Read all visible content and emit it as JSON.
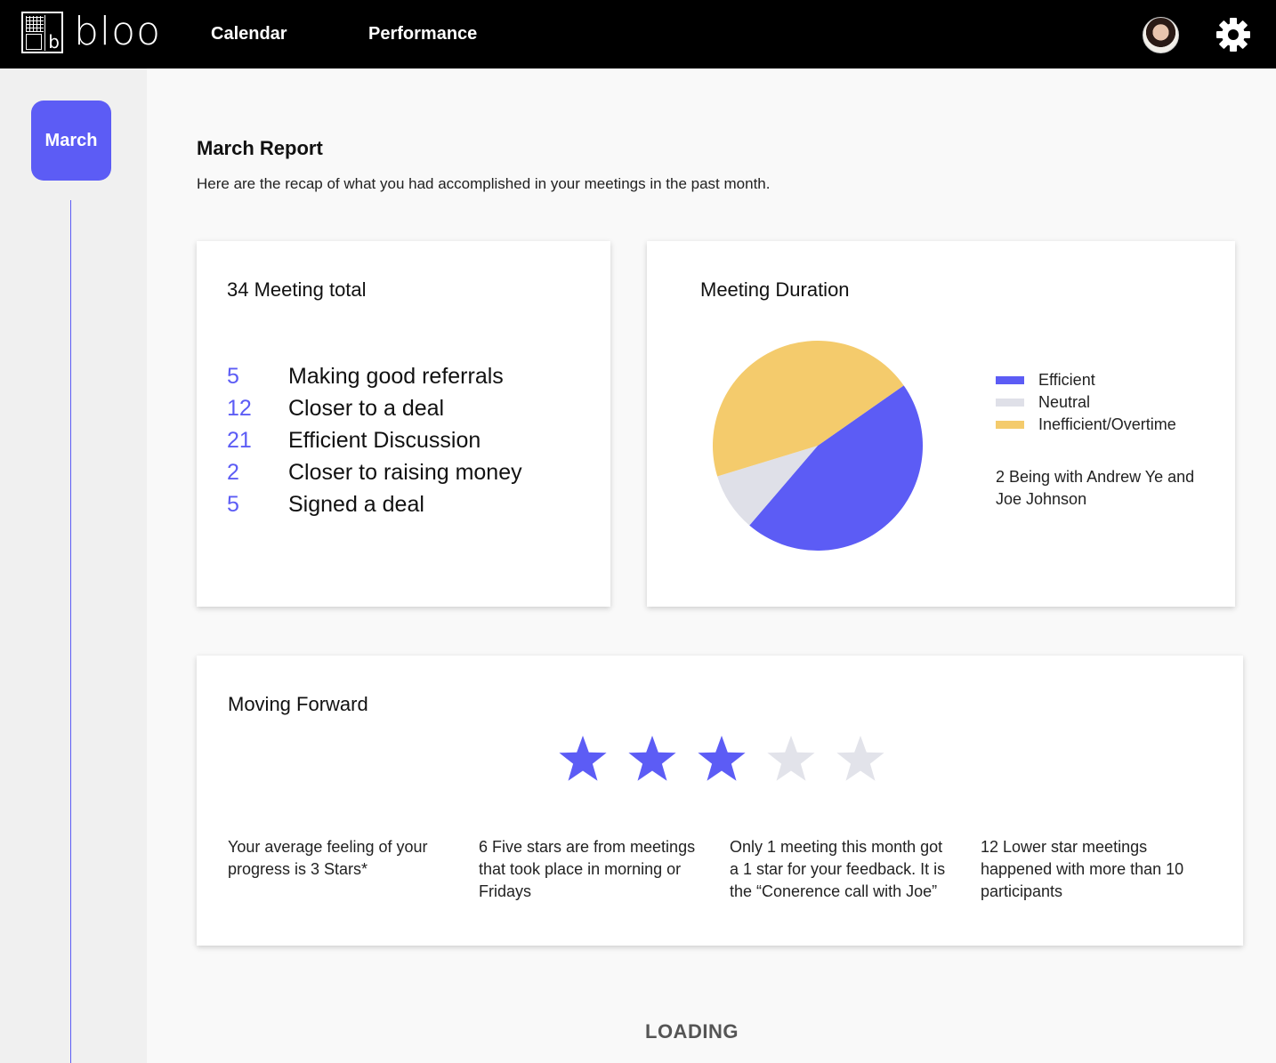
{
  "app": {
    "logo_text": "bloo",
    "logo_mark_letter": "b"
  },
  "nav": {
    "calendar": "Calendar",
    "performance": "Performance"
  },
  "sidebar": {
    "month": "March"
  },
  "header": {
    "title": "March Report",
    "subtitle": "Here are the recap of what you had accomplished in your meetings in the past month."
  },
  "totals_card": {
    "title": "34 Meeting total",
    "items": [
      {
        "count": "5",
        "label": "Making good referrals"
      },
      {
        "count": "12",
        "label": "Closer to a deal"
      },
      {
        "count": "21",
        "label": "Efficient Discussion"
      },
      {
        "count": "2",
        "label": "Closer to raising money"
      },
      {
        "count": "5",
        "label": "Signed a deal"
      }
    ]
  },
  "duration_card": {
    "title": "Meeting Duration",
    "note": "2 Being with Andrew Ye and Joe Johnson"
  },
  "chart_data": {
    "type": "pie",
    "slices": [
      {
        "name": "Efficient",
        "value": 0.46,
        "color": "#5c5cf5"
      },
      {
        "name": "Neutral",
        "value": 0.09,
        "color": "#dfe0e8"
      },
      {
        "name": "Inefficient/Overtime",
        "value": 0.45,
        "color": "#f4cb6c"
      }
    ],
    "legend_position": "right"
  },
  "forward_card": {
    "title": "Moving Forward",
    "rating": 3,
    "max_rating": 5,
    "star_color_on": "#5c5cf5",
    "star_color_off": "#e2e3ea",
    "insights": [
      "Your average feeling of your progress is 3 Stars*",
      "6 Five stars are from meetings that took place in  morning or Fridays",
      "Only 1 meeting this month got a 1 star for your feedback. It is the “Conerence call with Joe”",
      "12 Lower star meetings happened with more than 10 participants"
    ]
  },
  "footer": {
    "loading": "LOADING"
  },
  "icons": {
    "settings": "gear-icon",
    "profile": "avatar"
  }
}
